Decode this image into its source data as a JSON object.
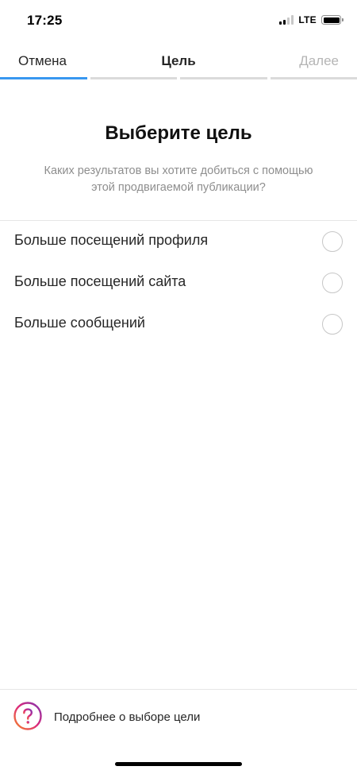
{
  "status_bar": {
    "time": "17:25",
    "network": "LTE",
    "signal_bars_active": 2,
    "signal_bars_total": 4,
    "battery_level": 1.0
  },
  "header": {
    "cancel_label": "Отмена",
    "title": "Цель",
    "next_label": "Далее",
    "progress_steps_total": 4,
    "progress_step_current": 1,
    "accent_color": "#3897f0"
  },
  "main": {
    "title": "Выберите цель",
    "subtitle": "Каких результатов вы хотите добиться с помощью этой продвигаемой публикации?"
  },
  "options": [
    {
      "label": "Больше посещений профиля",
      "selected": false
    },
    {
      "label": "Больше посещений сайта",
      "selected": false
    },
    {
      "label": "Больше сообщений",
      "selected": false
    }
  ],
  "footer": {
    "help_label": "Подробнее о выборе цели",
    "help_icon": "question-circle-icon"
  }
}
